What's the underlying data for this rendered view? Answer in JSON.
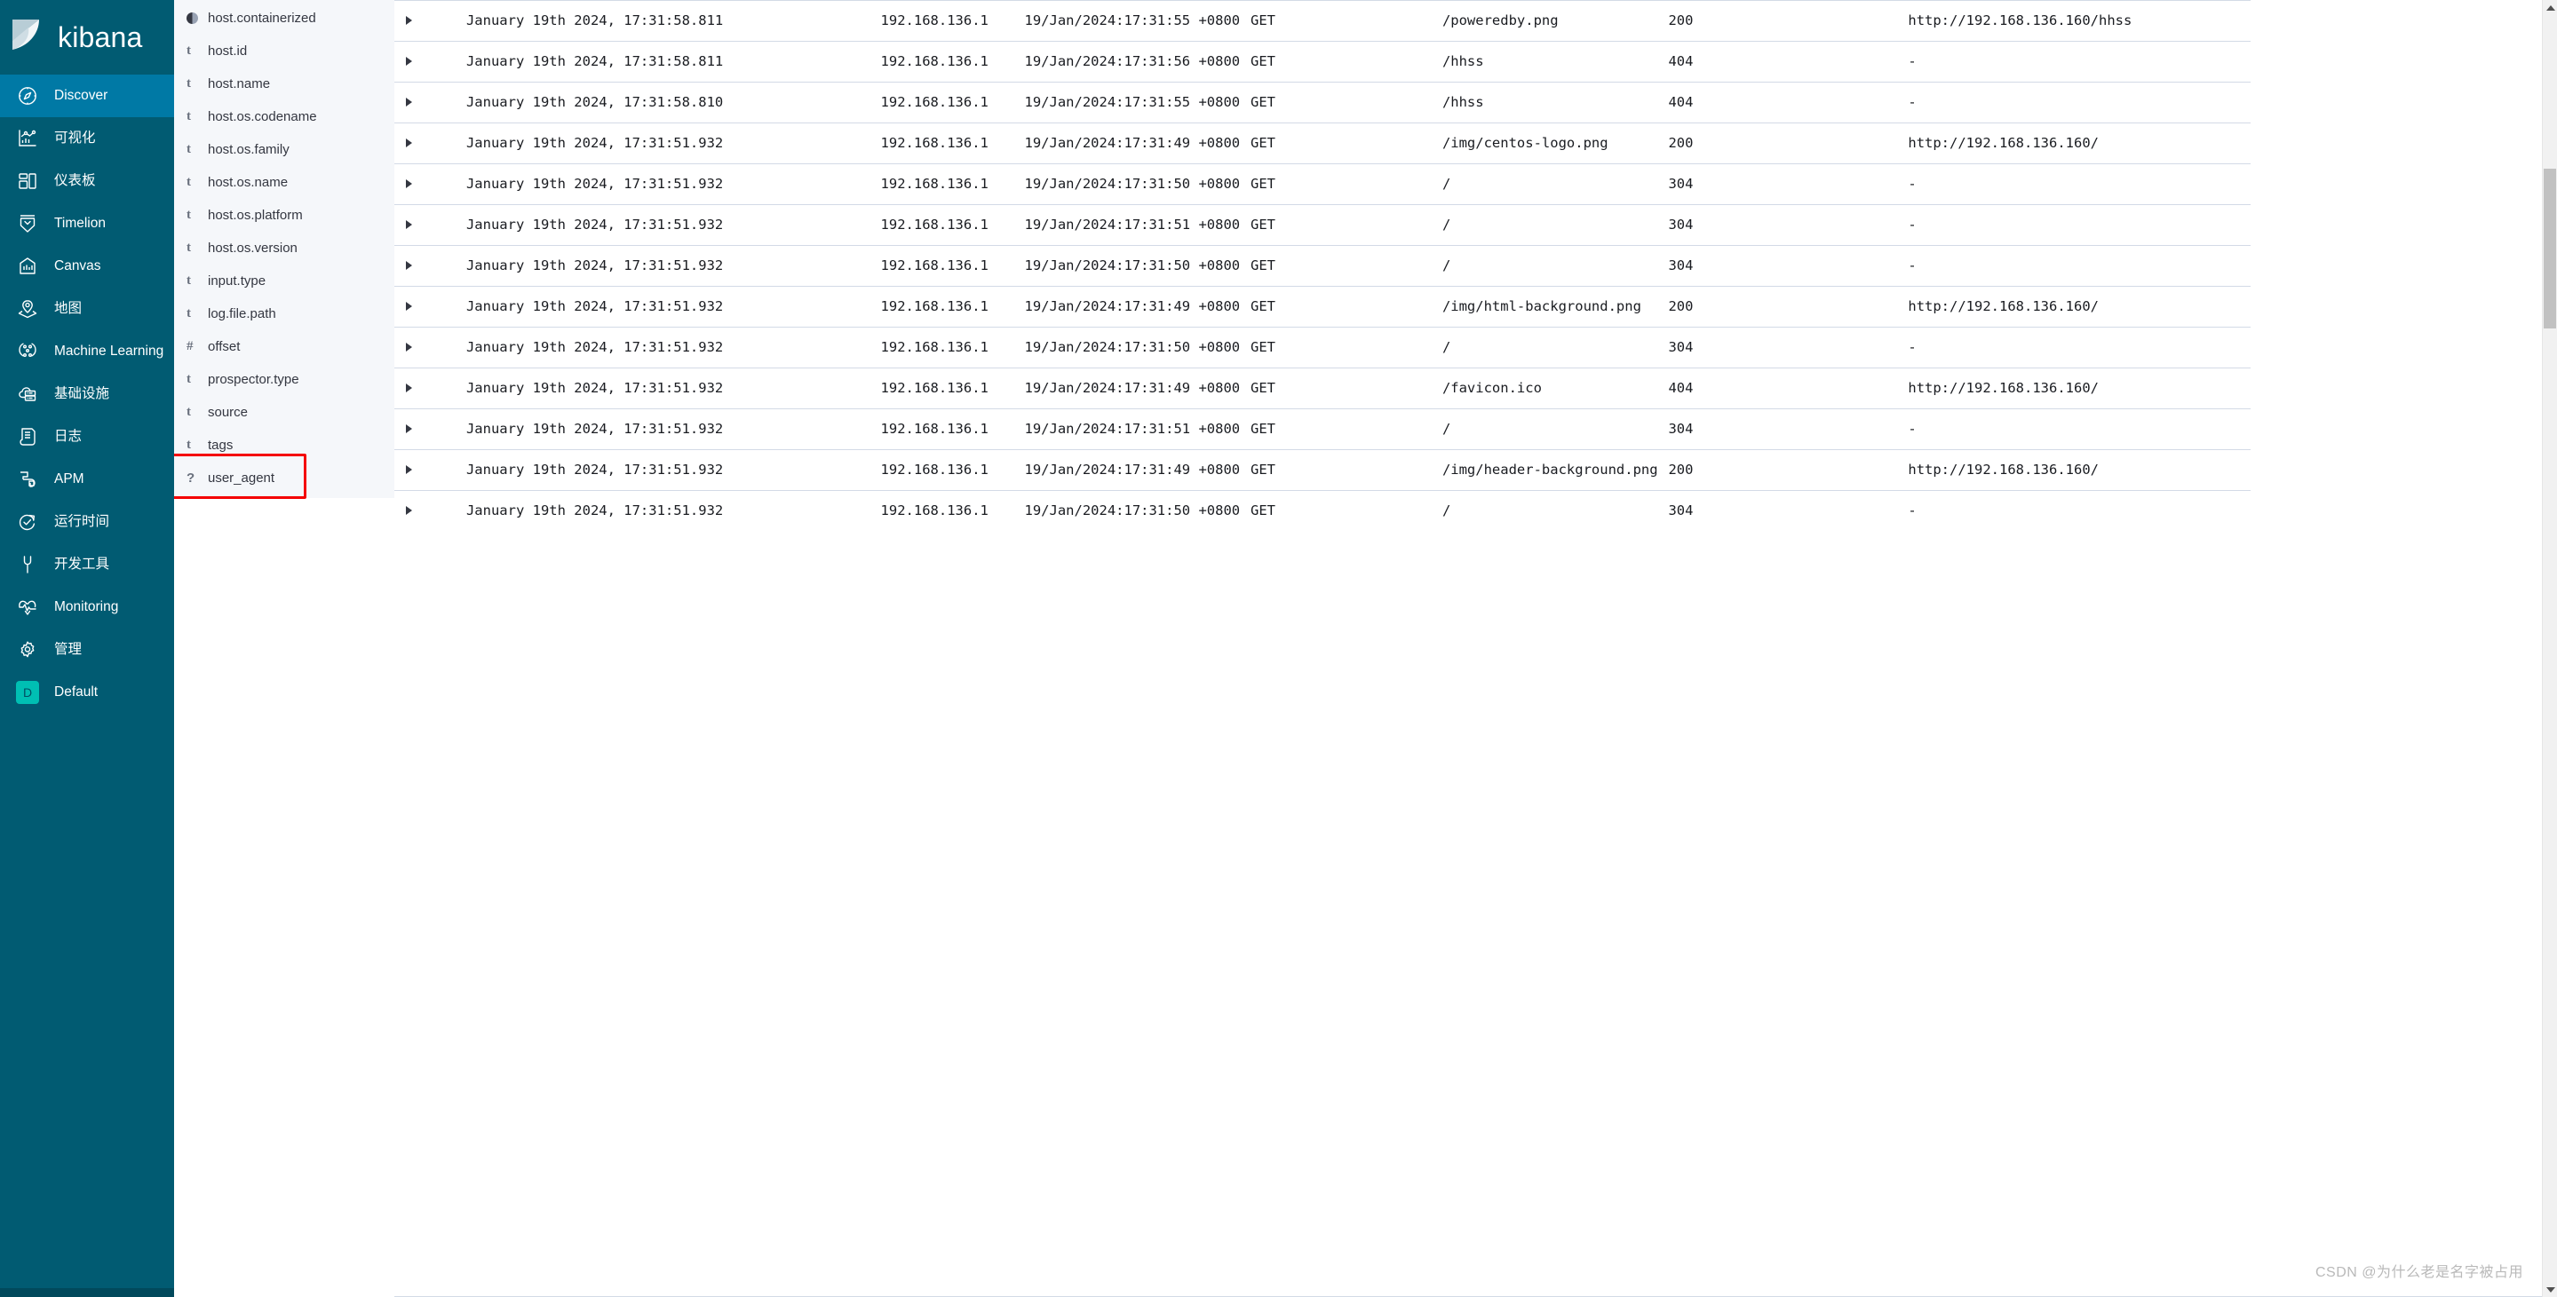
{
  "sidebar": {
    "brand": {
      "name": "kibana",
      "logo_icon": "kibana-logo-icon"
    },
    "items": [
      {
        "label": "Discover",
        "icon": "compass-icon",
        "active": true
      },
      {
        "label": "可视化",
        "icon": "visualize-chart-icon",
        "active": false
      },
      {
        "label": "仪表板",
        "icon": "dashboard-grid-icon",
        "active": false
      },
      {
        "label": "Timelion",
        "icon": "timelion-icon",
        "active": false
      },
      {
        "label": "Canvas",
        "icon": "canvas-frame-icon",
        "active": false
      },
      {
        "label": "地图",
        "icon": "map-pin-layers-icon",
        "active": false
      },
      {
        "label": "Machine Learning",
        "icon": "machine-learning-icon",
        "active": false
      },
      {
        "label": "基础设施",
        "icon": "infrastructure-cloud-icon",
        "active": false
      },
      {
        "label": "日志",
        "icon": "logs-scroll-icon",
        "active": false
      },
      {
        "label": "APM",
        "icon": "apm-icon",
        "active": false
      },
      {
        "label": "运行时间",
        "icon": "uptime-clock-icon",
        "active": false
      },
      {
        "label": "开发工具",
        "icon": "dev-tools-wrench-icon",
        "active": false
      },
      {
        "label": "Monitoring",
        "icon": "monitoring-heartbeat-icon",
        "active": false
      },
      {
        "label": "管理",
        "icon": "gear-icon",
        "active": false
      }
    ],
    "space": {
      "badge_letter": "D",
      "label": "Default"
    }
  },
  "field_panel": {
    "fields": [
      {
        "type_glyph": "conflict",
        "name": "host.containerized",
        "highlighted": false
      },
      {
        "type_glyph": "t",
        "name": "host.id",
        "highlighted": false
      },
      {
        "type_glyph": "t",
        "name": "host.name",
        "highlighted": false
      },
      {
        "type_glyph": "t",
        "name": "host.os.codename",
        "highlighted": false
      },
      {
        "type_glyph": "t",
        "name": "host.os.family",
        "highlighted": false
      },
      {
        "type_glyph": "t",
        "name": "host.os.name",
        "highlighted": false
      },
      {
        "type_glyph": "t",
        "name": "host.os.platform",
        "highlighted": false
      },
      {
        "type_glyph": "t",
        "name": "host.os.version",
        "highlighted": false
      },
      {
        "type_glyph": "t",
        "name": "input.type",
        "highlighted": false
      },
      {
        "type_glyph": "t",
        "name": "log.file.path",
        "highlighted": false
      },
      {
        "type_glyph": "#",
        "name": "offset",
        "highlighted": false
      },
      {
        "type_glyph": "t",
        "name": "prospector.type",
        "highlighted": false
      },
      {
        "type_glyph": "t",
        "name": "source",
        "highlighted": false
      },
      {
        "type_glyph": "t",
        "name": "tags",
        "highlighted": false
      },
      {
        "type_glyph": "?",
        "name": "user_agent",
        "highlighted": true
      }
    ],
    "highlight_color": "#f40000"
  },
  "doc_table": {
    "rows": [
      {
        "time": "January 19th 2024, 17:31:58.811",
        "ip": "192.168.136.1",
        "ts": "19/Jan/2024:17:31:55 +0800",
        "verb": "GET",
        "path": "/poweredby.png",
        "status": "200",
        "referrer": "http://192.168.136.160/hhss"
      },
      {
        "time": "January 19th 2024, 17:31:58.811",
        "ip": "192.168.136.1",
        "ts": "19/Jan/2024:17:31:56 +0800",
        "verb": "GET",
        "path": "/hhss",
        "status": "404",
        "referrer": "-"
      },
      {
        "time": "January 19th 2024, 17:31:58.810",
        "ip": "192.168.136.1",
        "ts": "19/Jan/2024:17:31:55 +0800",
        "verb": "GET",
        "path": "/hhss",
        "status": "404",
        "referrer": "-"
      },
      {
        "time": "January 19th 2024, 17:31:51.932",
        "ip": "192.168.136.1",
        "ts": "19/Jan/2024:17:31:49 +0800",
        "verb": "GET",
        "path": "/img/centos-logo.png",
        "status": "200",
        "referrer": "http://192.168.136.160/"
      },
      {
        "time": "January 19th 2024, 17:31:51.932",
        "ip": "192.168.136.1",
        "ts": "19/Jan/2024:17:31:50 +0800",
        "verb": "GET",
        "path": "/",
        "status": "304",
        "referrer": "-"
      },
      {
        "time": "January 19th 2024, 17:31:51.932",
        "ip": "192.168.136.1",
        "ts": "19/Jan/2024:17:31:51 +0800",
        "verb": "GET",
        "path": "/",
        "status": "304",
        "referrer": "-"
      },
      {
        "time": "January 19th 2024, 17:31:51.932",
        "ip": "192.168.136.1",
        "ts": "19/Jan/2024:17:31:50 +0800",
        "verb": "GET",
        "path": "/",
        "status": "304",
        "referrer": "-"
      },
      {
        "time": "January 19th 2024, 17:31:51.932",
        "ip": "192.168.136.1",
        "ts": "19/Jan/2024:17:31:49 +0800",
        "verb": "GET",
        "path": "/img/html-background.png",
        "status": "200",
        "referrer": "http://192.168.136.160/"
      },
      {
        "time": "January 19th 2024, 17:31:51.932",
        "ip": "192.168.136.1",
        "ts": "19/Jan/2024:17:31:50 +0800",
        "verb": "GET",
        "path": "/",
        "status": "304",
        "referrer": "-"
      },
      {
        "time": "January 19th 2024, 17:31:51.932",
        "ip": "192.168.136.1",
        "ts": "19/Jan/2024:17:31:49 +0800",
        "verb": "GET",
        "path": "/favicon.ico",
        "status": "404",
        "referrer": "http://192.168.136.160/"
      },
      {
        "time": "January 19th 2024, 17:31:51.932",
        "ip": "192.168.136.1",
        "ts": "19/Jan/2024:17:31:51 +0800",
        "verb": "GET",
        "path": "/",
        "status": "304",
        "referrer": "-"
      },
      {
        "time": "January 19th 2024, 17:31:51.932",
        "ip": "192.168.136.1",
        "ts": "19/Jan/2024:17:31:49 +0800",
        "verb": "GET",
        "path": "/img/header-background.png",
        "status": "200",
        "referrer": "http://192.168.136.160/"
      },
      {
        "time": "January 19th 2024, 17:31:51.932",
        "ip": "192.168.136.1",
        "ts": "19/Jan/2024:17:31:50 +0800",
        "verb": "GET",
        "path": "/",
        "status": "304",
        "referrer": "-"
      }
    ]
  },
  "watermark": {
    "text": "CSDN @为什么老是名字被占用"
  }
}
